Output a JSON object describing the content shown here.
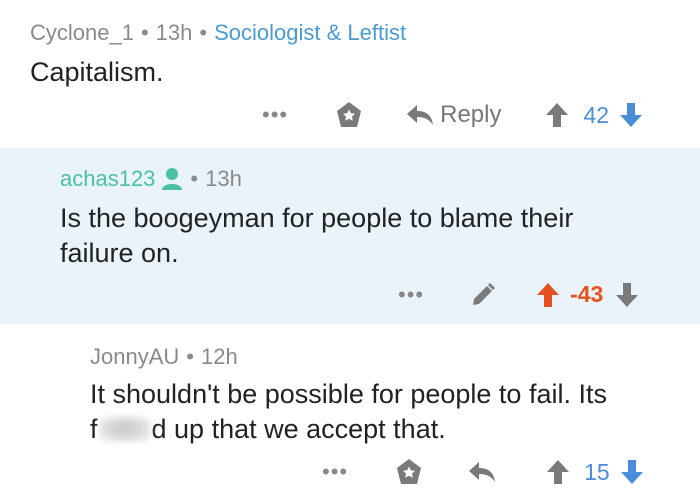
{
  "comments": [
    {
      "author": "Cyclone_1",
      "time": "13h",
      "flair": "Sociologist & Leftist",
      "body": "Capitalism.",
      "actions": {
        "more": "•••",
        "reply": "Reply",
        "score": "42"
      }
    },
    {
      "author": "achas123",
      "time": "13h",
      "body_line1": "Is the boogeyman for people to blame their",
      "body_line2": "failure on.",
      "actions": {
        "more": "•••",
        "score": "-43"
      }
    },
    {
      "author": "JonnyAU",
      "time": "12h",
      "body_line1": "It shouldn't be possible for people to fail. Its",
      "body_line2_prefix": "f",
      "body_line2_suffix": "d up that we accept that.",
      "actions": {
        "more": "•••",
        "score": "15"
      }
    }
  ],
  "separator": "•",
  "colors": {
    "accent_blue": "#4a8dd8",
    "downvoted_orange": "#e4531f",
    "author_teal": "#48c1a4",
    "highlight_bg": "#e9f3f9"
  },
  "icons": [
    "star-icon",
    "reply-arrow-icon",
    "upvote-icon",
    "downvote-icon",
    "user-icon",
    "pencil-icon"
  ]
}
